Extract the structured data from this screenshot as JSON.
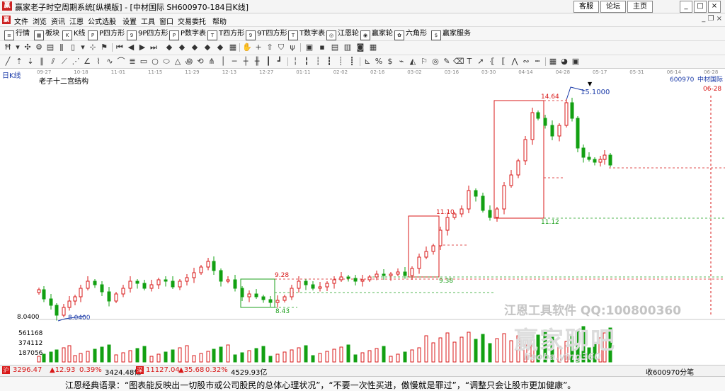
{
  "window": {
    "logo_text": "赢",
    "title": "赢家老子时空周期系统[纵横版] - [中材国际  SH600970-184日K线]",
    "top_buttons": [
      "客服",
      "论坛",
      "主页"
    ],
    "window_controls": [
      "_",
      "□",
      "×"
    ],
    "mdi_controls": "_ ❐ ×"
  },
  "menu": {
    "items": [
      "文件",
      "浏览",
      "资讯",
      "江恩",
      "公式选股",
      "设置",
      "工具",
      "窗口",
      "交易委托",
      "帮助"
    ]
  },
  "toolbar1": {
    "items": [
      {
        "icon": "list-icon",
        "glyph": "≡",
        "label": "行情"
      },
      {
        "icon": "grid-icon",
        "glyph": "▦",
        "label": "板块"
      },
      {
        "icon": "kline-icon",
        "glyph": "K",
        "label": "K线"
      },
      {
        "icon": "p-square-icon",
        "glyph": "P",
        "label": "P四方形"
      },
      {
        "icon": "9p-square-icon",
        "glyph": "9",
        "label": "9P四方形"
      },
      {
        "icon": "p-number-icon",
        "glyph": "P",
        "label": "P数字表"
      },
      {
        "icon": "t-square-icon",
        "glyph": "T",
        "label": "T四方形"
      },
      {
        "icon": "9t-square-icon",
        "glyph": "9",
        "label": "9T四方形"
      },
      {
        "icon": "t-number-icon",
        "glyph": "T",
        "label": "T数字表"
      },
      {
        "icon": "gann-wheel-icon",
        "glyph": "◎",
        "label": "江恩轮"
      },
      {
        "icon": "winner-wheel-icon",
        "glyph": "◉",
        "label": "赢家轮"
      },
      {
        "icon": "hexagon-icon",
        "glyph": "✿",
        "label": "六角形"
      },
      {
        "icon": "dollar-icon",
        "glyph": "$",
        "label": "赢家服务"
      }
    ]
  },
  "chart": {
    "period_label": "日K线",
    "title": "老子十二宫结构",
    "stock_code": "600970",
    "stock_name": "中材国际",
    "date_marker": "06-28",
    "timeline_dates": [
      "09-27",
      "10-18",
      "11-01",
      "11-15",
      "11-29",
      "12-13",
      "12-27",
      "01-11",
      "02-02",
      "02-16",
      "03-02",
      "03-16",
      "03-30",
      "04-14",
      "04-28",
      "05-17",
      "05-31",
      "06-14",
      "06-28"
    ],
    "price_label_low": "8.0400",
    "price_label_high": "15.1000",
    "axis_price": "8.0400",
    "annotations": [
      "9.28",
      "8.43",
      "9.38",
      "11.10",
      "11.12",
      "14.64"
    ],
    "volume_ticks": [
      "561168",
      "374112",
      "187056"
    ],
    "up_color": "#d81818",
    "down_color": "#12a012"
  },
  "watermark": {
    "line1": "江恩工具软件  QQ:100800360",
    "line2": "赢家聊吧",
    "line3": "liaoba.ying360"
  },
  "statusbar": {
    "sh_index": "3296.47",
    "sh_change": "▲12.93",
    "sh_pct": "0.39%",
    "sh_amount": "3424.48亿",
    "sz_index": "11127.04",
    "sz_change": "▲35.68",
    "sz_pct": "0.32%",
    "sz_amount": "4529.93亿",
    "right_text": "收600970分笔"
  },
  "quote": {
    "text": "江恩经典语录：“图表能反映出一切股市或公司股民的总体心理状况”，“不要一次性买进，傲慢就是罪过”，“调整只会让股市更加健康”。"
  }
}
